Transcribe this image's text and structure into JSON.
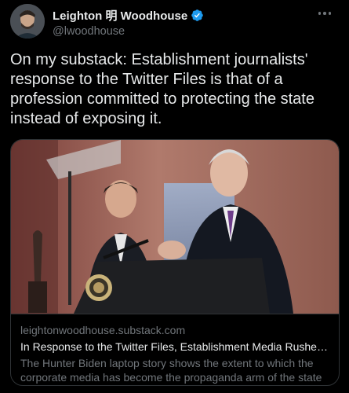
{
  "author": {
    "display_name": "Leighton 明 Woodhouse",
    "handle": "@lwoodhouse",
    "verified": true
  },
  "icons": {
    "avatar": "profile-photo",
    "verified": "verified-badge-icon",
    "more": "more-options-icon"
  },
  "tweet": {
    "text": "On my substack: Establishment journalists' response to the Twitter Files is that of a profession committed to protecting the state instead of exposing it."
  },
  "card": {
    "image_alt": "photo-of-podium-speaker",
    "domain": "leightonwoodhouse.substack.com",
    "title": "In Response to the Twitter Files, Establishment Media Rushes to...",
    "description": "The Hunter Biden laptop story shows the extent to which the corporate media has become the propaganda arm of the state"
  },
  "colors": {
    "background": "#000000",
    "text_primary": "#e7e9ea",
    "text_secondary": "#71767b",
    "border": "#2f3336",
    "verified_blue": "#1d9bf0"
  }
}
